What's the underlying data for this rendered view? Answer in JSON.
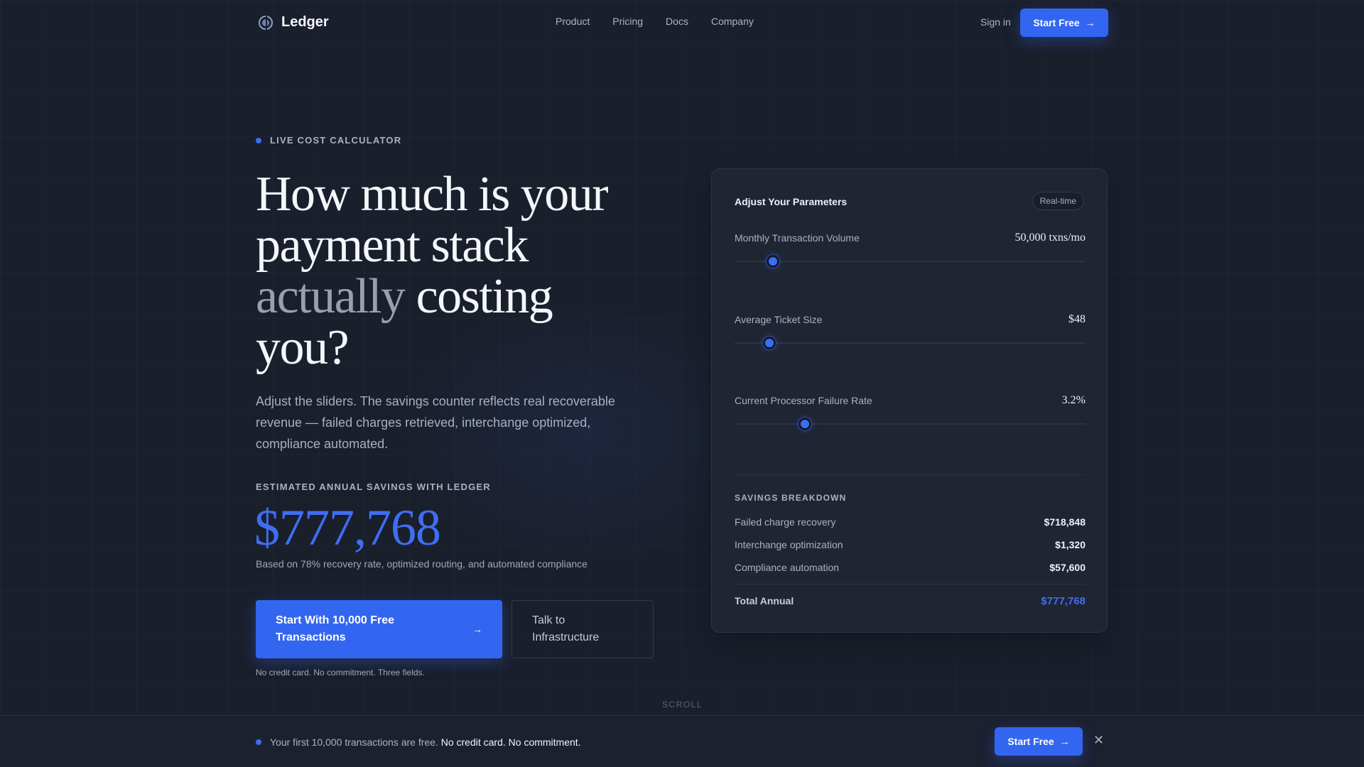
{
  "nav": {
    "brand": "Ledger",
    "links": [
      "Product",
      "Pricing",
      "Docs",
      "Company"
    ],
    "signin": "Sign in",
    "cta": "Start Free"
  },
  "hero": {
    "eyebrow": "LIVE COST CALCULATOR",
    "headline_1": "How much is your payment stack",
    "headline_muted": "actually",
    "headline_2": "costing you?",
    "subtitle": "Adjust the sliders. The savings counter reflects real recoverable revenue — failed charges retrieved, interchange optimized, compliance automated.",
    "savings_label": "ESTIMATED ANNUAL SAVINGS WITH LEDGER",
    "savings_value": "$777,768",
    "savings_note": "Based on 78% recovery rate, optimized routing, and automated compliance",
    "cta_primary": "Start With 10,000 Free Transactions",
    "cta_secondary": "Talk to Infrastructure",
    "cta_fine": "No credit card. No commitment. Three fields.",
    "scroll": "SCROLL"
  },
  "calculator": {
    "title": "Adjust Your Parameters",
    "badge": "Real-time",
    "params": [
      {
        "label": "Monthly Transaction Volume",
        "value": "50,000 txns/mo",
        "level": 0.11
      },
      {
        "label": "Average Ticket Size",
        "value": "$48",
        "level": 0.1
      },
      {
        "label": "Current Processor Failure Rate",
        "value": "3.2%",
        "level": 0.2
      }
    ],
    "breakdown_title": "SAVINGS BREAKDOWN",
    "rows": [
      {
        "label": "Failed charge recovery",
        "value": "$718,848"
      },
      {
        "label": "Interchange optimization",
        "value": "$1,320"
      },
      {
        "label": "Compliance automation",
        "value": "$57,600"
      }
    ],
    "total": {
      "label": "Total Annual",
      "value": "$777,768"
    }
  },
  "bottom_bar": {
    "message": "Your first 10,000 transactions are free.",
    "message_strong": "No credit card. No commitment.",
    "cta": "Start Free"
  },
  "colors": {
    "accent": "#3366f0",
    "background": "#1a1f2c",
    "card": "#1f2532"
  },
  "icons": [
    "ledger-logo-icon",
    "arrow-right-icon",
    "close-icon"
  ]
}
